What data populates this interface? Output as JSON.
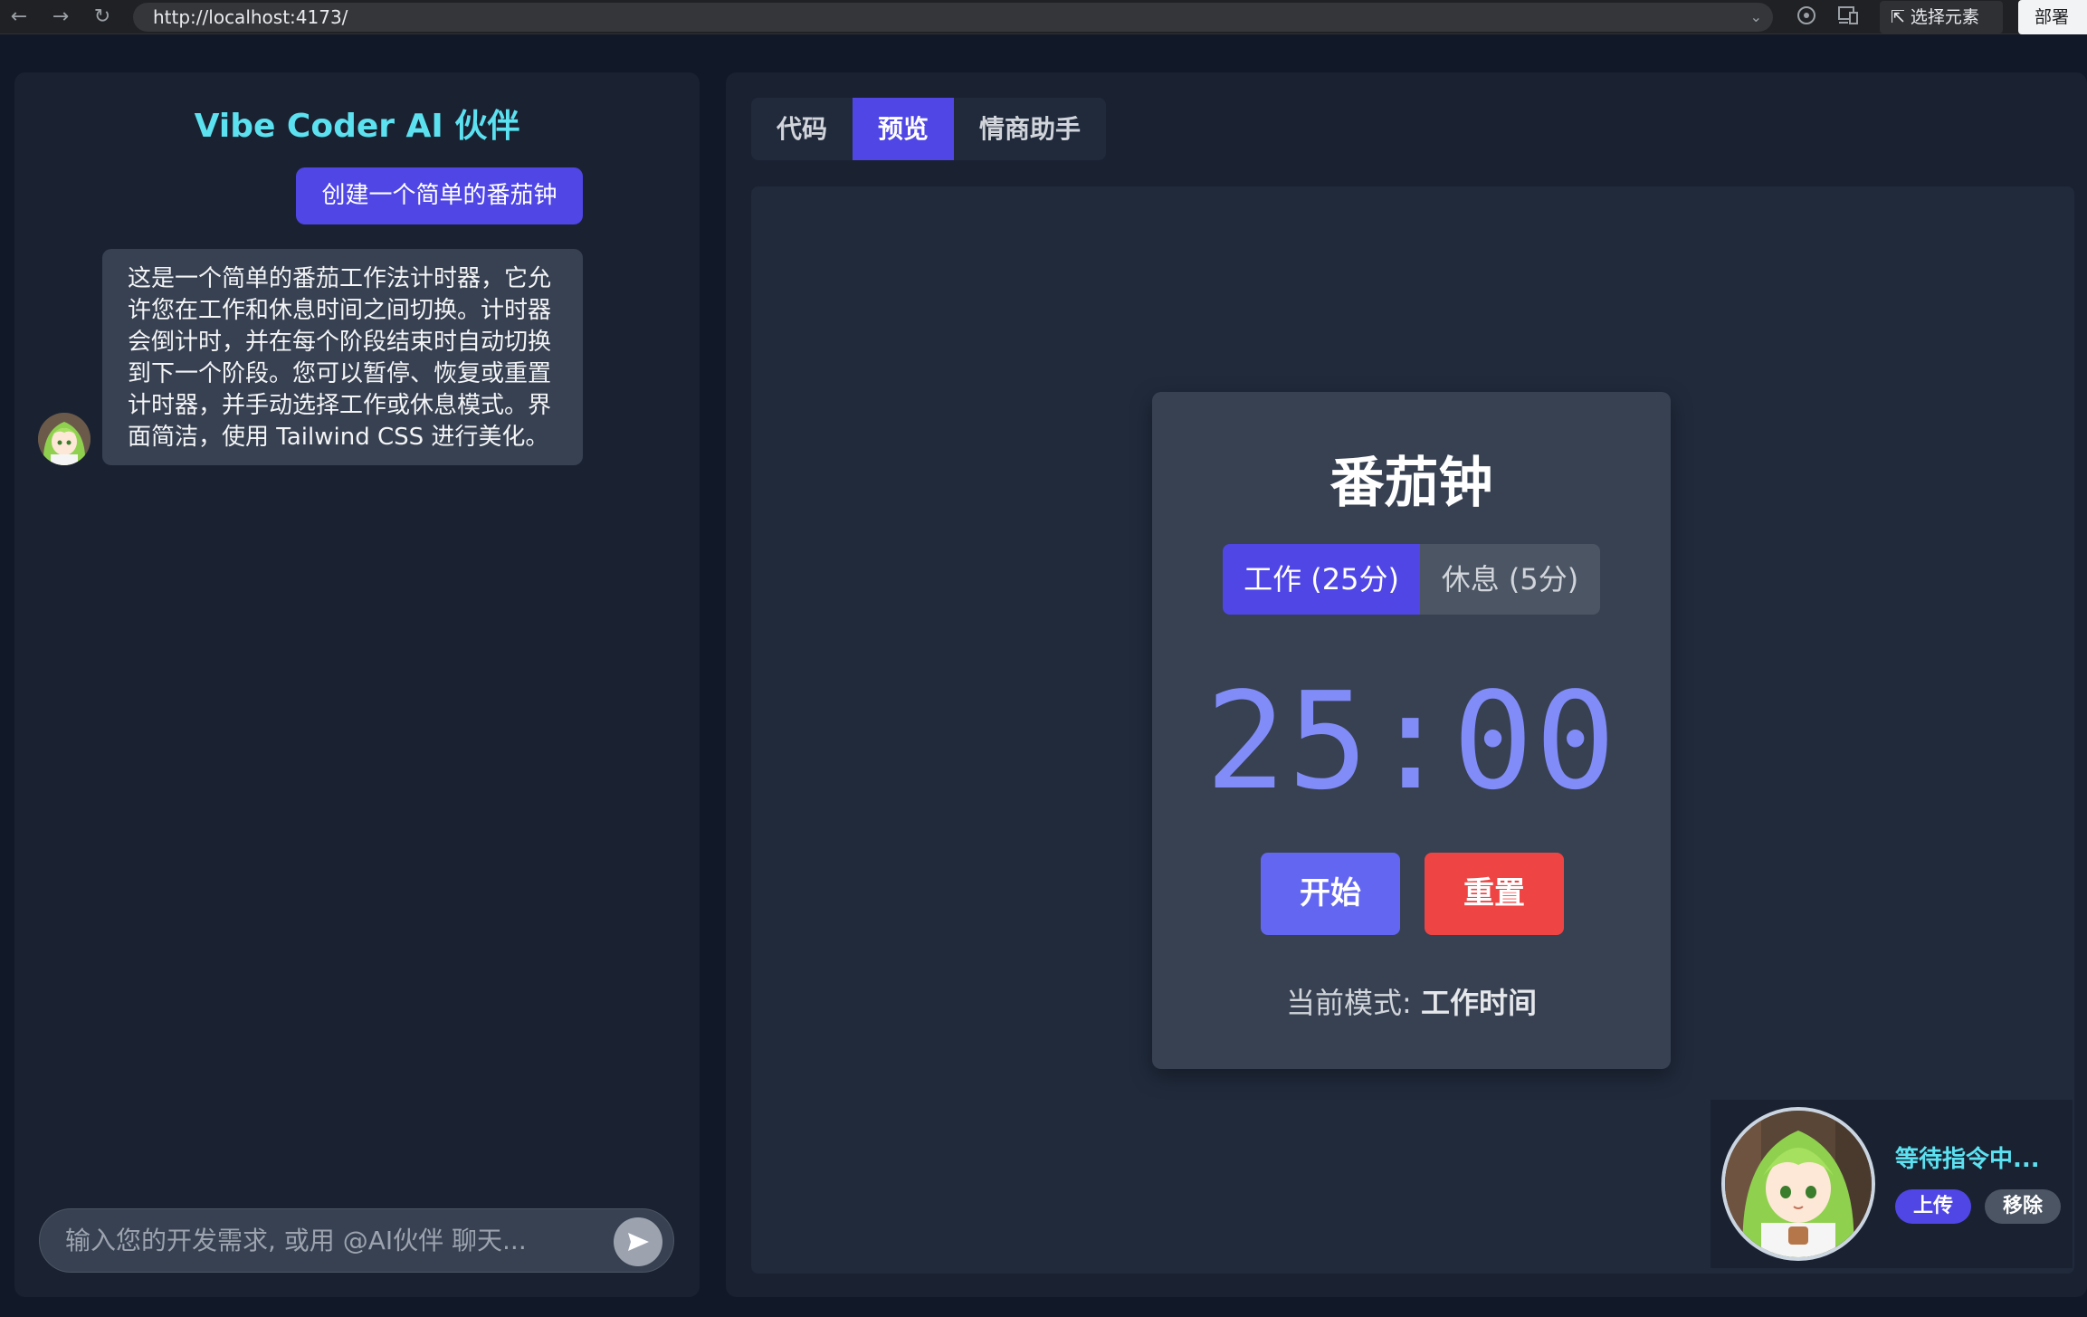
{
  "browser": {
    "url": "http://localhost:4173/",
    "inspect_label": "选择元素",
    "deploy_label": "部署"
  },
  "chat": {
    "title": "Vibe Coder AI 伙伴",
    "user_message": "创建一个简单的番茄钟",
    "ai_message": "这是一个简单的番茄工作法计时器，它允许您在工作和休息时间之间切换。计时器会倒计时，并在每个阶段结束时自动切换到下一个阶段。您可以暂停、恢复或重置计时器，并手动选择工作或休息模式。界面简洁，使用 Tailwind CSS 进行美化。",
    "input_placeholder": "输入您的开发需求, 或用 @AI伙伴 聊天..."
  },
  "tabs": [
    {
      "label": "代码",
      "active": false
    },
    {
      "label": "预览",
      "active": true
    },
    {
      "label": "情商助手",
      "active": false
    }
  ],
  "pomodoro": {
    "title": "番茄钟",
    "work_label": "工作 (25分)",
    "break_label": "休息 (5分)",
    "timer": "25:00",
    "start_label": "开始",
    "reset_label": "重置",
    "mode_prefix": "当前模式:",
    "mode_value": "工作时间"
  },
  "assistant": {
    "status": "等待指令中...",
    "upload_label": "上传",
    "remove_label": "移除"
  },
  "colors": {
    "accent": "#4f46e5",
    "title_cyan": "#5ce1f0",
    "timer": "#818cf8",
    "reset": "#ef4444"
  }
}
